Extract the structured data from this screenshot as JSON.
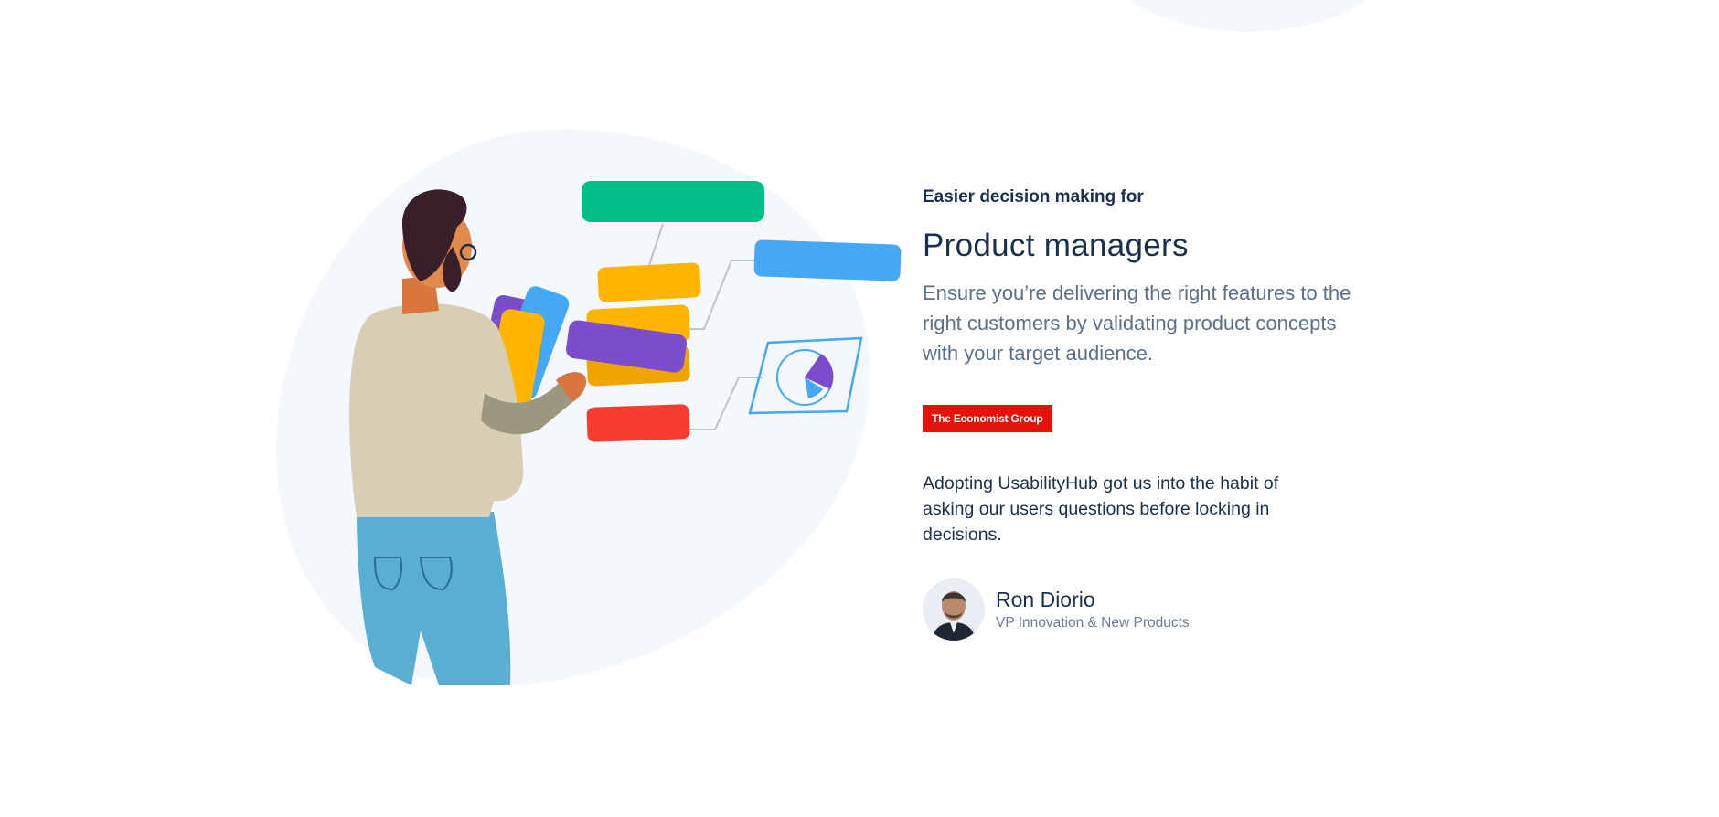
{
  "hero": {
    "eyebrow": "Easier decision making for",
    "title": "Product managers",
    "description": "Ensure you’re delivering the right features to the right customers by validating product concepts with your target audience."
  },
  "logo": {
    "text": "The Economist Group",
    "color": "#e3120b"
  },
  "testimonial": {
    "quote": "Adopting UsabilityHub got us into the habit of asking our users questions before locking in decisions.",
    "author_name": "Ron Diorio",
    "author_title": "VP Innovation & New Products"
  },
  "colors": {
    "heading": "#1a2f4b",
    "body_text": "#5b7087",
    "blob_background": "#f4f8fc",
    "card_green": "#00be87",
    "card_blue": "#44a8f5",
    "card_yellow": "#ffb400",
    "card_purple": "#7b4ccc",
    "card_red": "#f53c2e"
  },
  "icons": {
    "illustration": "person-with-flowchart-illustration",
    "pie_chart": "pie-chart-icon",
    "avatar": "ron-diorio-avatar"
  }
}
